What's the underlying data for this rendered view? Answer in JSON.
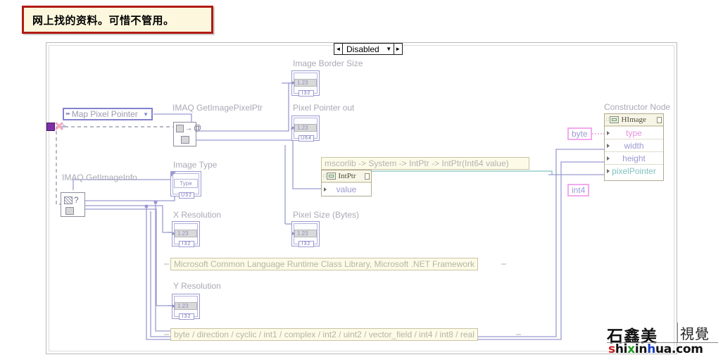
{
  "comment": {
    "text": "网上找的资料。可惜不管用。",
    "border_color": "#b01a14",
    "background_color": "#fdf8dd"
  },
  "structure": {
    "selector": {
      "left_arrow": "◄",
      "label": "Disabled",
      "dropdown": "▼",
      "right_arrow": "►"
    }
  },
  "controls": {
    "map_pixel_pointer": {
      "label": "Map Pixel Pointer",
      "left_right_glyph": "⬌",
      "caret": "▼"
    }
  },
  "nodes": {
    "imaq_get_image_pixel_ptr": {
      "label": "IMAQ GetImagePixelPtr",
      "glyph_at": "@",
      "glyph_arrow": "→",
      "badge": "ⓘ"
    },
    "imaq_get_image_info": {
      "label": "IMAQ GetImageInfo",
      "question": "?",
      "badge": "ⓘ"
    },
    "intptr_constructor": {
      "header": "mscorlib -> System -> IntPtr -> IntPtr(Int64 value)",
      "title": "IntPtr",
      "rows": [
        "value"
      ]
    },
    "constructor_node": {
      "label": "Constructor Node",
      "title": "HImage",
      "rows": [
        "type",
        "width",
        "height",
        "pixelPointer"
      ]
    }
  },
  "indicators": [
    {
      "name": "Image Border Size",
      "value": "1.23",
      "type": "I32"
    },
    {
      "name": "Pixel Pointer out",
      "value": "1.23",
      "type": "U64"
    },
    {
      "name": "X Resolution",
      "value": "1.23",
      "type": "I32"
    },
    {
      "name": "Pixel Size (Bytes)",
      "value": "1.23",
      "type": "I32"
    },
    {
      "name": "Y Resolution",
      "value": "1.23",
      "type": "I32"
    }
  ],
  "image_type_indicator": {
    "name": "Image Type",
    "value": "Type",
    "type": "U32",
    "left_arrow": "◂",
    "right_arrow": "▸"
  },
  "constants": {
    "byte": "byte",
    "int4": "int4"
  },
  "free_labels": {
    "runtime_library": "Microsoft Common Language Runtime Class Library, Microsoft .NET Framework",
    "type_list": "byte / direction / cyclic / int1 / complex / int2 / uint2 / vector_field / int4 / int8 / real"
  },
  "watermark": {
    "chinese": "石鑫美",
    "seal": "視覺",
    "domain_parts": [
      "s",
      "hi",
      "x",
      "in",
      "h",
      "ua.com"
    ]
  },
  "colors": {
    "wire_blue": "#9a9ad2",
    "wire_teal": "#7fc3bd",
    "wire_pink": "#e8a8e4",
    "label_gray": "#a9a9b6",
    "structure_border": "#b9b9b9"
  }
}
